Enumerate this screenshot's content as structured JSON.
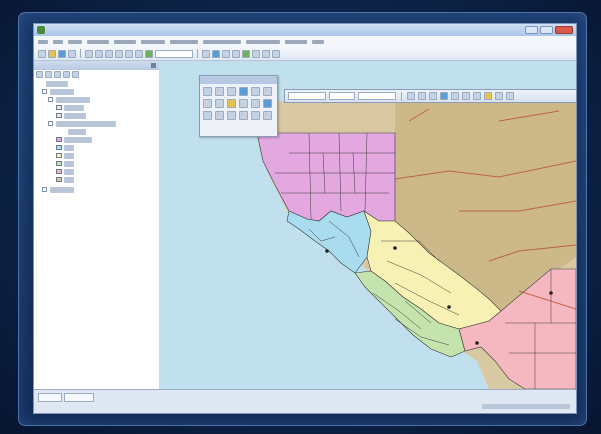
{
  "window": {
    "title": "",
    "icon": "app-globe-icon"
  },
  "menu": [],
  "toc": {
    "title": "",
    "layers": []
  },
  "map": {
    "labels": [],
    "colors": {
      "ocean": "#bfe0ec",
      "land": "#d9c9a3",
      "nevada": "#cdb889",
      "region_north": "#e3a8e0",
      "region_bay": "#a9dcee",
      "region_central": "#f7f2b4",
      "region_coast": "#c5e3ad",
      "region_south": "#f6b8c0",
      "county_lines": "#3a3a3a",
      "roads": "#b5512e"
    }
  },
  "status": {
    "tabs": [],
    "coordinates": ""
  }
}
